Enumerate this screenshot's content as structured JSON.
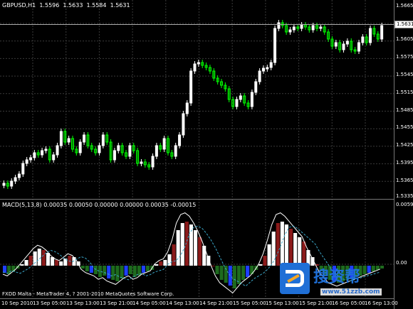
{
  "window": {
    "price_header": "GBPUSD,H1  1.5596  1.5633  1.5584  1.5631",
    "macd_header": "MACD(5,13,8) 0.00035 0.00050 0.00000 0.00000 0.00035 -0.00015",
    "footer": "FXDD Malta - MetaTrader 4, ? 2001-2010 MetaQuotes Software Corp."
  },
  "price_axis": {
    "labels": [
      "1.5665",
      "1.5631",
      "1.5605",
      "1.5575",
      "1.5545",
      "1.5515",
      "1.5485",
      "1.5455",
      "1.5425",
      "1.5395",
      "1.5365",
      "1.5335"
    ],
    "current_price": "1.5631"
  },
  "macd_axis": {
    "labels": [
      "0.0059",
      "0.00"
    ]
  },
  "time_axis": {
    "labels": [
      "10 Sep 2010",
      "13 Sep 05:00",
      "13 Sep 13:00",
      "13 Sep 21:00",
      "14 Sep 05:00",
      "14 Sep 13:00",
      "14 Sep 21:00",
      "15 Sep 05:00",
      "15 Sep 13:00",
      "15 Sep 21:00",
      "16 Sep 05:00",
      "16 Sep 13:00"
    ]
  },
  "watermark": {
    "brand": "搜资帮",
    "url": "www.51zzb.com"
  },
  "colors": {
    "background": "#000000",
    "grid": "#3a3a3a",
    "bull_candle": "#ffffff",
    "bear_candle": "#00ff00",
    "macd_positive": "#8b1a1a",
    "macd_negative": "#1e6b1e",
    "macd_line": "#ffffff",
    "signal_line": "#3aa7c9",
    "histogram_blue": "#1e3fff"
  }
}
